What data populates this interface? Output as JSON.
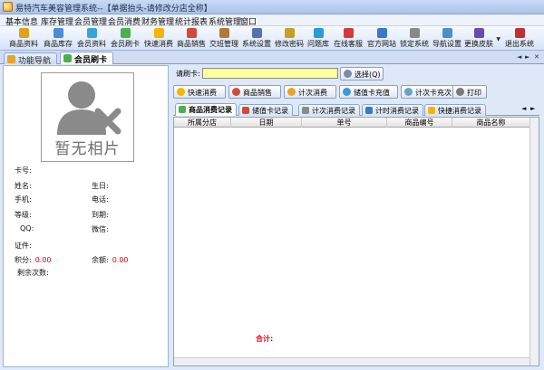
{
  "window": {
    "title": "易特汽车美容管理系统--【单据抬头-请修改分店全称】"
  },
  "menu": [
    "基本信息",
    "库存管理",
    "会员管理",
    "会员消费",
    "财务管理",
    "统计报表",
    "系统管理",
    "窗口"
  ],
  "toolbar": [
    {
      "label": "商品资料",
      "icon": "goods-info-icon",
      "color": "#e0a020"
    },
    {
      "label": "商品库存",
      "icon": "stock-icon",
      "color": "#4a8fd6"
    },
    {
      "label": "会员资料",
      "icon": "member-info-icon",
      "color": "#3aa4d8"
    },
    {
      "label": "会员刷卡",
      "icon": "card-swipe-icon",
      "color": "#4caf50"
    },
    {
      "label": "快速消费",
      "icon": "quick-consume-icon",
      "color": "#f2b600"
    },
    {
      "label": "商品销售",
      "icon": "goods-sale-icon",
      "color": "#d14a3a"
    },
    {
      "label": "交班管理",
      "icon": "shift-icon",
      "color": "#b07a38"
    },
    {
      "label": "系统设置",
      "icon": "settings-icon",
      "color": "#5a6fb0"
    },
    {
      "label": "修改密码",
      "icon": "password-icon",
      "color": "#c7a020"
    },
    {
      "label": "问题库",
      "icon": "question-icon",
      "color": "#2a9bd8"
    },
    {
      "label": "在线客服",
      "icon": "support-icon",
      "color": "#d33a3a"
    },
    {
      "label": "官方网站",
      "icon": "website-icon",
      "color": "#3a78c8"
    },
    {
      "label": "锁定系统",
      "icon": "lock-icon",
      "color": "#888888"
    },
    {
      "label": "导航设置",
      "icon": "nav-settings-icon",
      "color": "#4a90c8"
    },
    {
      "label": "更换皮肤",
      "icon": "skin-icon",
      "color": "#6a4ab0"
    },
    {
      "label": "退出系统",
      "icon": "exit-icon",
      "color": "#c03030"
    }
  ],
  "tabs": [
    {
      "label": "功能导航",
      "active": false
    },
    {
      "label": "会员刷卡",
      "active": true
    }
  ],
  "member": {
    "photo_placeholder": "暂无相片",
    "fields": {
      "card_no": "卡号:",
      "name": "姓名:",
      "birthday": "生日:",
      "mobile": "手机:",
      "phone": "电话:",
      "level": "等级:",
      "expiry": "到期:",
      "qq": "QQ:",
      "wechat": "微信:",
      "id_card": "证件:",
      "points": "积分:",
      "balance": "余额:",
      "remaining": "剩余次数:"
    },
    "points_value": "0.00",
    "balance_value": "0.00"
  },
  "card_search": {
    "label": "请刷卡:",
    "value": "",
    "button": "选择(Q)"
  },
  "actions": [
    "快速消费",
    "商品销售",
    "计次消费",
    "储值卡充值",
    "计次卡充次",
    "打印"
  ],
  "record_tabs": [
    "商品消费记录",
    "储值卡记录",
    "计次消费记录",
    "计时消费记录",
    "快捷消费记录"
  ],
  "grid": {
    "columns": [
      "所属分店",
      "日期",
      "单号",
      "商品编号",
      "商品名称"
    ],
    "rows": [],
    "total_label": "合计:"
  }
}
